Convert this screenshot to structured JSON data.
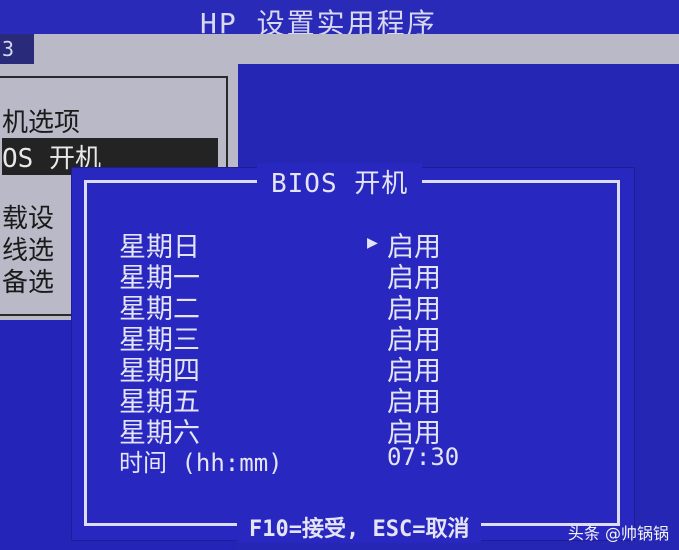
{
  "header": {
    "title": "HP 设置实用程序"
  },
  "menu": {
    "tab_fragment": "З"
  },
  "left_menu": {
    "items": [
      {
        "label": "机选项"
      },
      {
        "label": "OS 开机"
      },
      {
        "label": "载设"
      },
      {
        "label": "线选"
      },
      {
        "label": "备选"
      }
    ],
    "selected_index": 1
  },
  "dialog": {
    "title": "BIOS 开机",
    "rows": [
      {
        "label": "星期日",
        "value": "启用"
      },
      {
        "label": "星期一",
        "value": "启用"
      },
      {
        "label": "星期二",
        "value": "启用"
      },
      {
        "label": "星期三",
        "value": "启用"
      },
      {
        "label": "星期四",
        "value": "启用"
      },
      {
        "label": "星期五",
        "value": "启用"
      },
      {
        "label": "星期六",
        "value": "启用"
      },
      {
        "label": "时间 (hh:mm)",
        "value": "07:30"
      }
    ],
    "pointer": "▶",
    "footer": "F10=接受, ESC=取消"
  },
  "watermark": "头条 @帅锅锅",
  "colors": {
    "background": "#2424b8",
    "menu_grey": "#b9b9c7",
    "selected_bar": "#232323",
    "text": "#e4e4f6"
  }
}
